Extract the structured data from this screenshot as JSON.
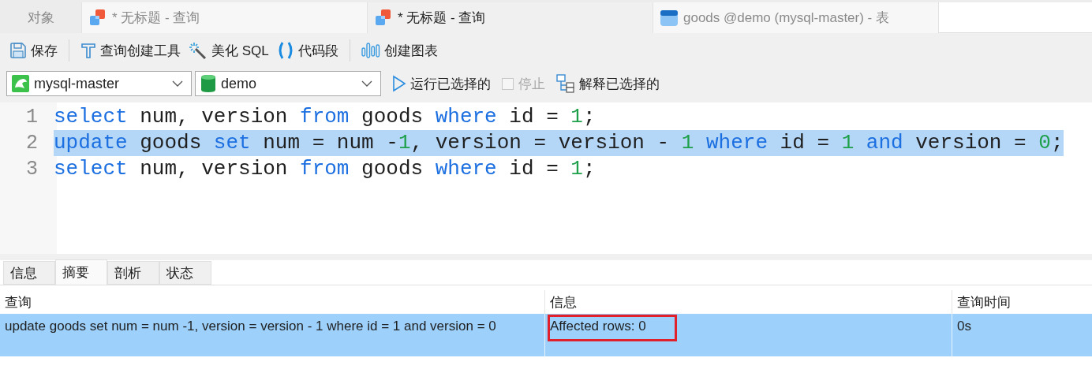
{
  "tabs": [
    {
      "label": "对象",
      "kind": "plain",
      "selected": false
    },
    {
      "label": "* 无标题 - 查询",
      "kind": "query",
      "selected": false
    },
    {
      "label": "* 无标题 - 查询",
      "kind": "query",
      "selected": true
    },
    {
      "label": "goods @demo (mysql-master) - 表",
      "kind": "table",
      "selected": false
    }
  ],
  "toolbar": [
    {
      "label": "保存",
      "kind": "save",
      "divider_after": true
    },
    {
      "label": "查询创建工具",
      "kind": "builder",
      "divider_after": false
    },
    {
      "label": "美化 SQL",
      "kind": "beautify",
      "divider_after": false
    },
    {
      "label": "代码段",
      "kind": "snippet",
      "divider_after": true
    },
    {
      "label": "创建图表",
      "kind": "chart",
      "divider_after": false
    }
  ],
  "connection": {
    "value": "mysql-master"
  },
  "database": {
    "value": "demo"
  },
  "run_button": {
    "label": "运行已选择的"
  },
  "stop": {
    "label": "停止",
    "checked": false,
    "disabled": true
  },
  "explain_button": {
    "label": "解释已选择的"
  },
  "editor": {
    "lines": [
      {
        "number": "1",
        "selected": false,
        "tokens": [
          {
            "kind": "keyword",
            "text": "select"
          },
          {
            "kind": "plain",
            "text": " num, version "
          },
          {
            "kind": "keyword",
            "text": "from"
          },
          {
            "kind": "plain",
            "text": " goods "
          },
          {
            "kind": "keyword",
            "text": "where"
          },
          {
            "kind": "plain",
            "text": " id = "
          },
          {
            "kind": "number",
            "text": "1"
          },
          {
            "kind": "plain",
            "text": ";"
          }
        ]
      },
      {
        "number": "2",
        "selected": true,
        "tokens": [
          {
            "kind": "keyword",
            "text": "update"
          },
          {
            "kind": "plain",
            "text": " goods "
          },
          {
            "kind": "keyword",
            "text": "set"
          },
          {
            "kind": "plain",
            "text": " num = num -"
          },
          {
            "kind": "number",
            "text": "1"
          },
          {
            "kind": "plain",
            "text": ", version = version - "
          },
          {
            "kind": "number",
            "text": "1"
          },
          {
            "kind": "keyword",
            "text": " where"
          },
          {
            "kind": "plain",
            "text": " id = "
          },
          {
            "kind": "number",
            "text": "1"
          },
          {
            "kind": "keyword",
            "text": " and"
          },
          {
            "kind": "plain",
            "text": " version = "
          },
          {
            "kind": "number",
            "text": "0"
          },
          {
            "kind": "plain",
            "text": ";"
          }
        ]
      },
      {
        "number": "3",
        "selected": false,
        "tokens": [
          {
            "kind": "keyword",
            "text": "select"
          },
          {
            "kind": "plain",
            "text": " num, version "
          },
          {
            "kind": "keyword",
            "text": "from"
          },
          {
            "kind": "plain",
            "text": " goods "
          },
          {
            "kind": "keyword",
            "text": "where"
          },
          {
            "kind": "plain",
            "text": " id = "
          },
          {
            "kind": "number",
            "text": "1"
          },
          {
            "kind": "plain",
            "text": ";"
          }
        ]
      }
    ]
  },
  "result_tabs": [
    {
      "label": "信息",
      "selected": false
    },
    {
      "label": "摘要",
      "selected": true
    },
    {
      "label": "剖析",
      "selected": false
    },
    {
      "label": "状态",
      "selected": false
    }
  ],
  "table": {
    "columns": [
      "查询",
      "信息",
      "查询时间"
    ],
    "rows": [
      {
        "selected": true,
        "cells": [
          {
            "text": "update goods set num = num -1, version = version - 1 where id = 1 and version = 0",
            "annotated": false
          },
          {
            "text": "Affected rows: 0",
            "annotated": true
          },
          {
            "text": "0s",
            "annotated": false
          }
        ]
      }
    ]
  }
}
